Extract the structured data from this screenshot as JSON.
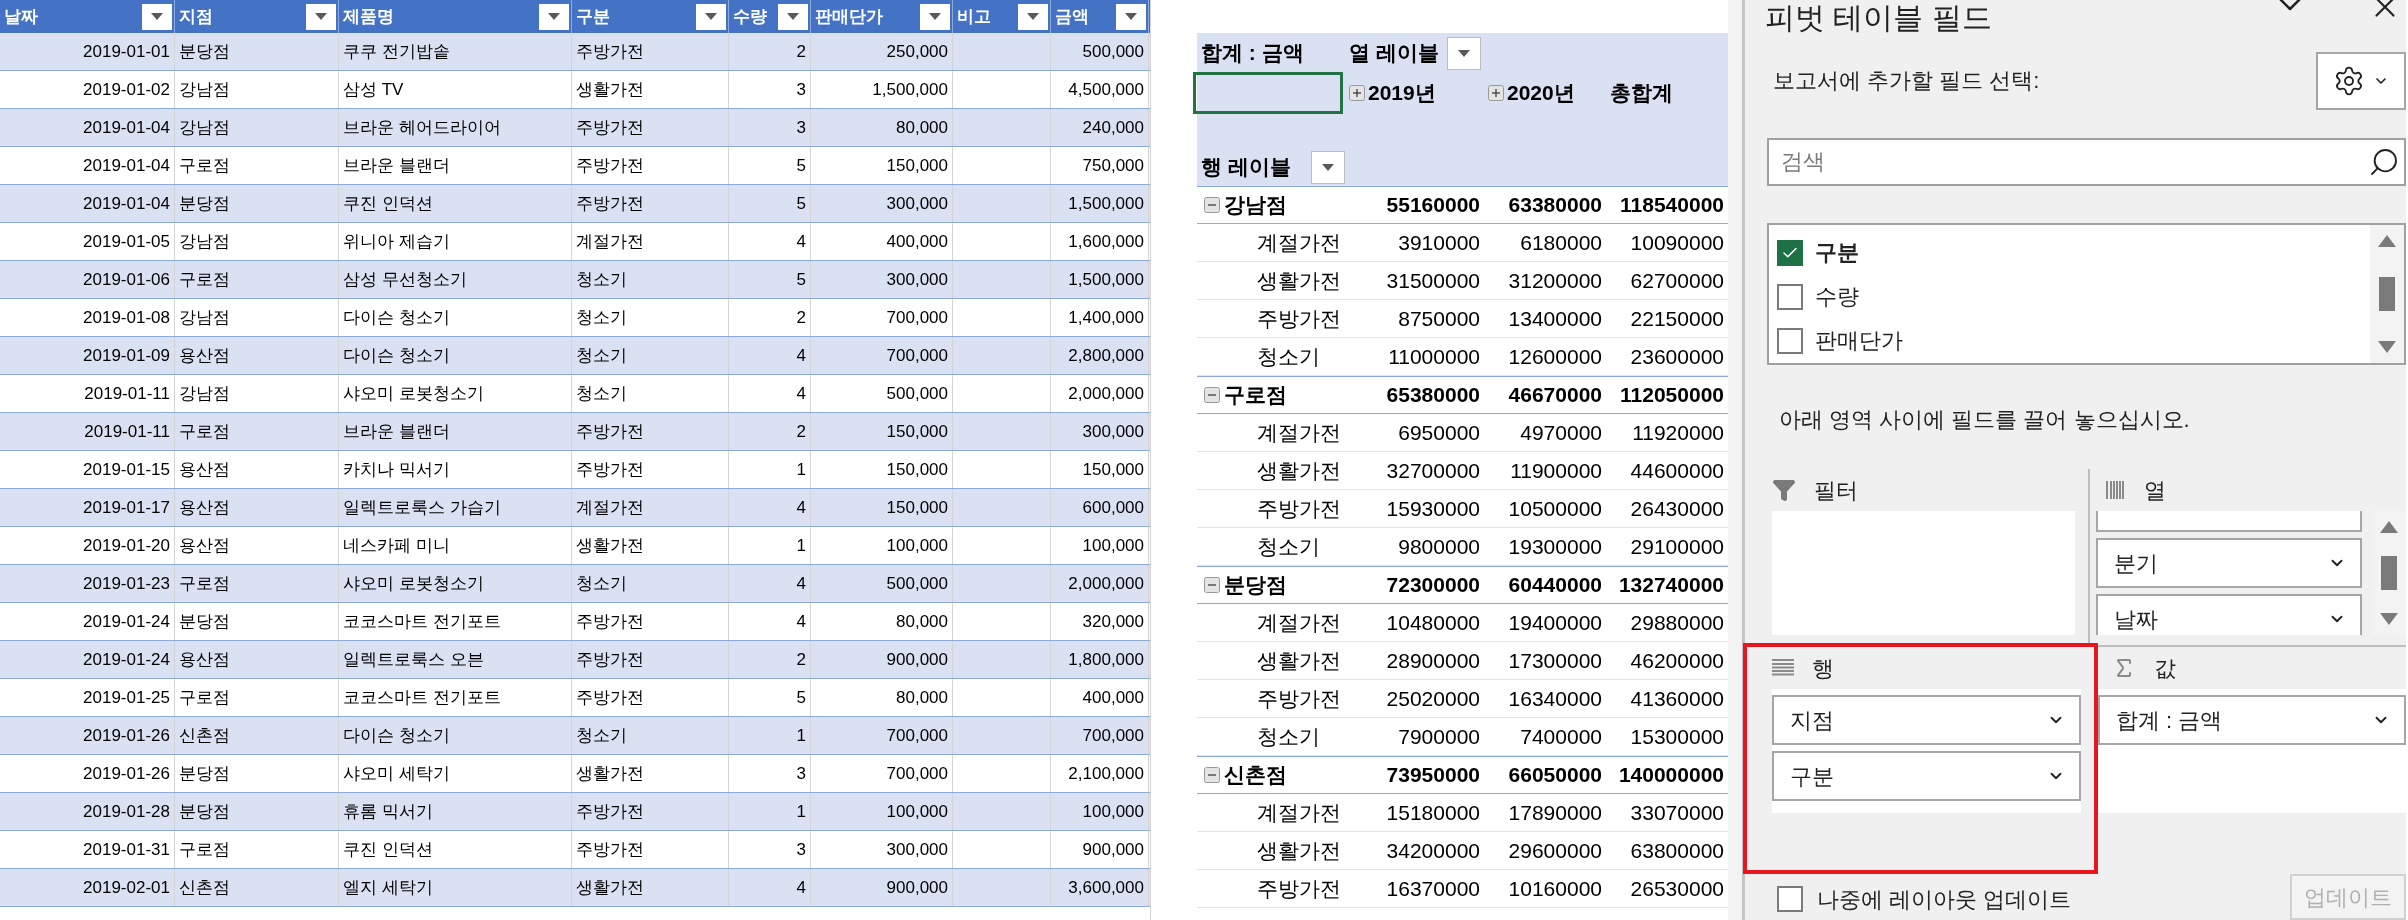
{
  "table": {
    "columns": [
      {
        "label": "날짜",
        "kind": "date"
      },
      {
        "label": "지점",
        "kind": "text"
      },
      {
        "label": "제품명",
        "kind": "text"
      },
      {
        "label": "구분",
        "kind": "text"
      },
      {
        "label": "수량",
        "kind": "number"
      },
      {
        "label": "판매단가",
        "kind": "number"
      },
      {
        "label": "비고",
        "kind": "blank"
      },
      {
        "label": "금액",
        "kind": "number"
      }
    ],
    "rows": [
      [
        "2019-01-01",
        "분당점",
        "쿠쿠 전기밥솥",
        "주방가전",
        "2",
        "250,000",
        "500,000"
      ],
      [
        "2019-01-02",
        "강남점",
        "삼성 TV",
        "생활가전",
        "3",
        "1,500,000",
        "4,500,000"
      ],
      [
        "2019-01-04",
        "강남점",
        "브라운 헤어드라이어",
        "주방가전",
        "3",
        "80,000",
        "240,000"
      ],
      [
        "2019-01-04",
        "구로점",
        "브라운 블랜더",
        "주방가전",
        "5",
        "150,000",
        "750,000"
      ],
      [
        "2019-01-04",
        "분당점",
        "쿠진 인덕션",
        "주방가전",
        "5",
        "300,000",
        "1,500,000"
      ],
      [
        "2019-01-05",
        "강남점",
        "위니아 제습기",
        "계절가전",
        "4",
        "400,000",
        "1,600,000"
      ],
      [
        "2019-01-06",
        "구로점",
        "삼성 무선청소기",
        "청소기",
        "5",
        "300,000",
        "1,500,000"
      ],
      [
        "2019-01-08",
        "강남점",
        "다이슨 청소기",
        "청소기",
        "2",
        "700,000",
        "1,400,000"
      ],
      [
        "2019-01-09",
        "용산점",
        "다이슨 청소기",
        "청소기",
        "4",
        "700,000",
        "2,800,000"
      ],
      [
        "2019-01-11",
        "강남점",
        "샤오미 로봇청소기",
        "청소기",
        "4",
        "500,000",
        "2,000,000"
      ],
      [
        "2019-01-11",
        "구로점",
        "브라운 블랜더",
        "주방가전",
        "2",
        "150,000",
        "300,000"
      ],
      [
        "2019-01-15",
        "용산점",
        "카치나 믹서기",
        "주방가전",
        "1",
        "150,000",
        "150,000"
      ],
      [
        "2019-01-17",
        "용산점",
        "일렉트로룩스 가습기",
        "계절가전",
        "4",
        "150,000",
        "600,000"
      ],
      [
        "2019-01-20",
        "용산점",
        "네스카페 미니",
        "생활가전",
        "1",
        "100,000",
        "100,000"
      ],
      [
        "2019-01-23",
        "구로점",
        "샤오미 로봇청소기",
        "청소기",
        "4",
        "500,000",
        "2,000,000"
      ],
      [
        "2019-01-24",
        "분당점",
        "코코스마트 전기포트",
        "주방가전",
        "4",
        "80,000",
        "320,000"
      ],
      [
        "2019-01-24",
        "용산점",
        "일렉트로룩스 오븐",
        "주방가전",
        "2",
        "900,000",
        "1,800,000"
      ],
      [
        "2019-01-25",
        "구로점",
        "코코스마트 전기포트",
        "주방가전",
        "5",
        "80,000",
        "400,000"
      ],
      [
        "2019-01-26",
        "신촌점",
        "다이슨 청소기",
        "청소기",
        "1",
        "700,000",
        "700,000"
      ],
      [
        "2019-01-26",
        "분당점",
        "샤오미 세탁기",
        "생활가전",
        "3",
        "700,000",
        "2,100,000"
      ],
      [
        "2019-01-28",
        "분당점",
        "휴롬 믹서기",
        "주방가전",
        "1",
        "100,000",
        "100,000"
      ],
      [
        "2019-01-31",
        "구로점",
        "쿠진 인덕션",
        "주방가전",
        "3",
        "300,000",
        "900,000"
      ],
      [
        "2019-02-01",
        "신촌점",
        "엘지 세탁기",
        "생활가전",
        "4",
        "900,000",
        "3,600,000"
      ]
    ]
  },
  "pivot": {
    "value_label": "합계 : 금액",
    "column_label": "열 레이블",
    "row_label": "행 레이블",
    "column_headers": [
      {
        "label": "2019년",
        "kind": "field",
        "expanded": false
      },
      {
        "label": "2020년",
        "kind": "field",
        "expanded": false
      },
      {
        "label": "총합계",
        "kind": "total"
      }
    ],
    "groups": [
      {
        "label": "강남점",
        "expanded": true,
        "values": [
          "55160000",
          "63380000",
          "118540000"
        ],
        "children": [
          {
            "label": "계절가전",
            "values": [
              "3910000",
              "6180000",
              "10090000"
            ]
          },
          {
            "label": "생활가전",
            "values": [
              "31500000",
              "31200000",
              "62700000"
            ]
          },
          {
            "label": "주방가전",
            "values": [
              "8750000",
              "13400000",
              "22150000"
            ]
          },
          {
            "label": "청소기",
            "values": [
              "11000000",
              "12600000",
              "23600000"
            ]
          }
        ]
      },
      {
        "label": "구로점",
        "expanded": true,
        "values": [
          "65380000",
          "46670000",
          "112050000"
        ],
        "children": [
          {
            "label": "계절가전",
            "values": [
              "6950000",
              "4970000",
              "11920000"
            ]
          },
          {
            "label": "생활가전",
            "values": [
              "32700000",
              "11900000",
              "44600000"
            ]
          },
          {
            "label": "주방가전",
            "values": [
              "15930000",
              "10500000",
              "26430000"
            ]
          },
          {
            "label": "청소기",
            "values": [
              "9800000",
              "19300000",
              "29100000"
            ]
          }
        ]
      },
      {
        "label": "분당점",
        "expanded": true,
        "values": [
          "72300000",
          "60440000",
          "132740000"
        ],
        "children": [
          {
            "label": "계절가전",
            "values": [
              "10480000",
              "19400000",
              "29880000"
            ]
          },
          {
            "label": "생활가전",
            "values": [
              "28900000",
              "17300000",
              "46200000"
            ]
          },
          {
            "label": "주방가전",
            "values": [
              "25020000",
              "16340000",
              "41360000"
            ]
          },
          {
            "label": "청소기",
            "values": [
              "7900000",
              "7400000",
              "15300000"
            ]
          }
        ]
      },
      {
        "label": "신촌점",
        "expanded": true,
        "values": [
          "73950000",
          "66050000",
          "140000000"
        ],
        "children": [
          {
            "label": "계절가전",
            "values": [
              "15180000",
              "17890000",
              "33070000"
            ]
          },
          {
            "label": "생활가전",
            "values": [
              "34200000",
              "29600000",
              "63800000"
            ]
          },
          {
            "label": "주방가전",
            "values": [
              "16370000",
              "10160000",
              "26530000"
            ]
          }
        ]
      }
    ]
  },
  "field_pane": {
    "title": "피벗 테이블 필드",
    "subtitle": "보고서에 추가할 필드 선택:",
    "search": {
      "placeholder": "검색"
    },
    "fields": [
      {
        "label": "구분",
        "checked": true
      },
      {
        "label": "수량",
        "checked": false
      },
      {
        "label": "판매단가",
        "checked": false
      }
    ],
    "instruction": "아래 영역 사이에 필드를 끌어 놓으십시오.",
    "filters": {
      "label": "필터"
    },
    "columns": {
      "label": "열",
      "items": [
        "분기",
        "날짜"
      ]
    },
    "rows": {
      "label": "행",
      "highlighted": true,
      "items": [
        "지점",
        "구분"
      ]
    },
    "values": {
      "label": "값",
      "items": [
        "합계 : 금액"
      ]
    },
    "defer_update": {
      "label": "나중에 레이아웃 업데이트",
      "checked": false
    },
    "update_button": {
      "label": "업데이트",
      "disabled": true
    }
  }
}
